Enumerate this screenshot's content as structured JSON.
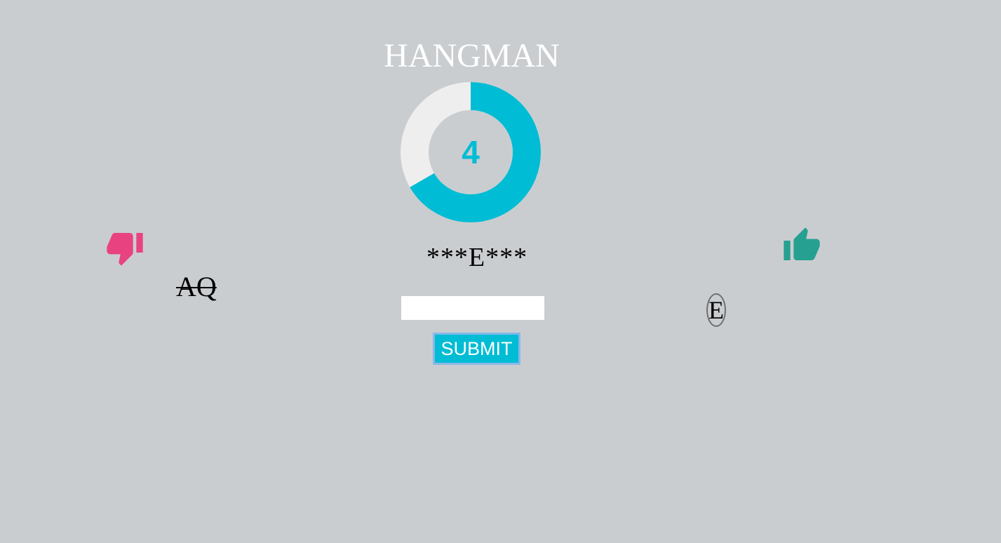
{
  "title": "HANGMAN",
  "remaining_guesses": {
    "label": "4",
    "value": 4,
    "max": 6,
    "fill_color": "#00bcd4",
    "track_color": "#eeeeee"
  },
  "word_display": "***E***",
  "wrong_letters": "AQ",
  "correct_letters": [
    "E"
  ],
  "guess_input": {
    "value": "",
    "placeholder": ""
  },
  "submit_label": "SUBMIT",
  "icons": {
    "wrong": "thumbs-down-icon",
    "correct": "thumbs-up-icon"
  },
  "colors": {
    "background": "#cacdd0",
    "accent": "#00bcd4",
    "wrong": "#e94281",
    "correct": "#26a091"
  }
}
